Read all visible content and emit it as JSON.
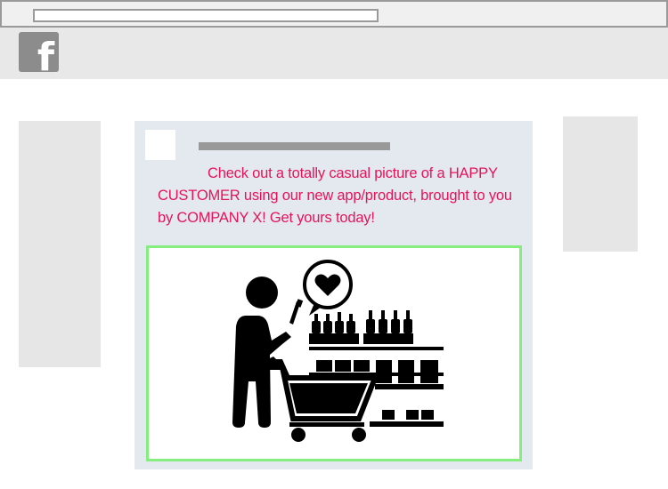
{
  "browser": {
    "address": ""
  },
  "header": {
    "logo_icon": "facebook-icon",
    "logo_glyph": "f"
  },
  "post": {
    "text": "Check out a totally casual picture of a HAPPY CUSTOMER using our new app/product, brought to you by COMPANY X! Get yours today!",
    "text_color": "#e5145a",
    "image": {
      "icon": "shopping-customer-icon",
      "frame_color": "#86ee7e"
    }
  }
}
